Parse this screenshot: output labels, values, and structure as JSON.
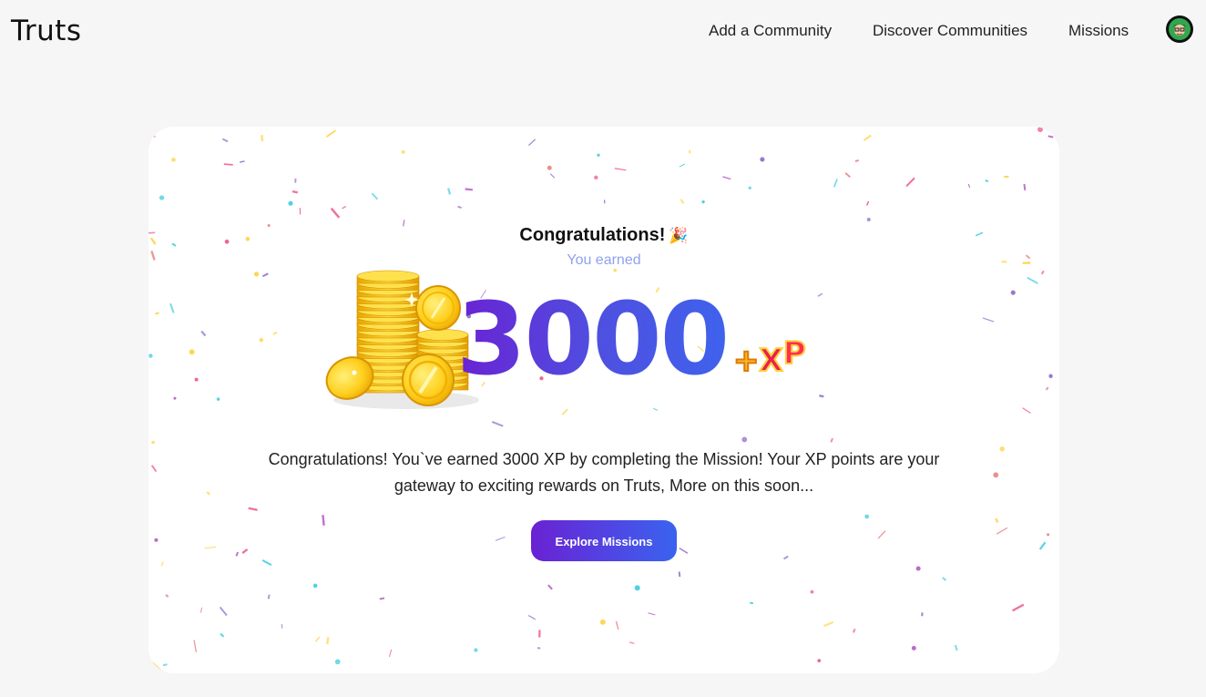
{
  "header": {
    "logo": "Truts",
    "nav": [
      "Add a Community",
      "Discover Communities",
      "Missions"
    ],
    "avatar_icon": "user-avatar-icon"
  },
  "card": {
    "title": "Congratulations!",
    "title_emoji": "🎉",
    "subtitle": "You earned",
    "xp_amount": "3000",
    "xp_badge_text": "+XP",
    "message": "Congratulations! You`ve earned 3000 XP by completing the Mission! Your XP points are your gateway to exciting rewards on Truts, More on this soon...",
    "cta_label": "Explore Missions"
  },
  "colors": {
    "accent_start": "#6a22d3",
    "accent_end": "#3a63f0",
    "subtitle": "#8fa2ee",
    "page_bg": "#f6f6f6",
    "card_bg": "#ffffff"
  }
}
